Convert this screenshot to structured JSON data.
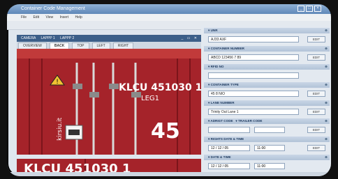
{
  "window": {
    "title": "Container Code Management"
  },
  "menu": [
    "File",
    "Edit",
    "View",
    "Insert",
    "Help"
  ],
  "camera_tabs": {
    "tab1": "CAMERA",
    "tab2": "LAPPP 1",
    "tab3": "LAPPP 2",
    "controls": "_ ▭ ✕"
  },
  "view_tabs": [
    "OVERVIEW",
    "BACK",
    "TOP",
    "LEFT",
    "RIGHT"
  ],
  "photo_text": {
    "code_top": "KLCU  451030 1",
    "sub_code": "LEG1",
    "big_number": "45",
    "side_text": "kirsiu.it",
    "code_bottom": "KLCU  451030 1"
  },
  "fields": {
    "f1": {
      "label": "UNR",
      "value": "AJ33 AXF",
      "button": "EDIT"
    },
    "f2": {
      "label": "CONTAINER NUMBER",
      "value": "ABCD 123456 7 89",
      "button": "EDIT"
    },
    "f3": {
      "label": "RFID NO",
      "value": ""
    },
    "f4": {
      "label": "CONTAINER TYPE",
      "value": "45 8 NIO",
      "button": "EDIT"
    },
    "f5": {
      "label": "LANE NUMBER",
      "value": "Trinity Out Lane 1",
      "button": "EDIT"
    },
    "f6": {
      "label": "ADRIGT CODE",
      "label2": "TRAILER CODE",
      "value1": "",
      "value2": "",
      "button": "EDIT"
    },
    "f7": {
      "label": "RIGHTS DATE & TIME",
      "value1": "12 / 12 / 05",
      "value2": "11:00",
      "button": "EDIT"
    },
    "f8": {
      "label": "DATE & TIME",
      "value1": "12 / 12 / 05",
      "value2": "11:00"
    }
  },
  "icons": {
    "expand": "plus-icon",
    "collapse": "triangle-icon"
  },
  "colors": {
    "container_red": "#b1262a",
    "accent_blue": "#3c5f89"
  }
}
